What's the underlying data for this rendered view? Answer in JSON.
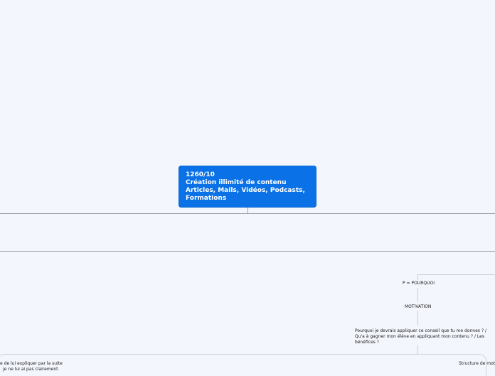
{
  "root": {
    "line1": "1260/10",
    "line2": "Création illimité de contenu",
    "line3": "Articles, Mails, Vidéos, Podcasts,",
    "line4": "Formations"
  },
  "nodes": {
    "p_pourquoi": "P = POURQUOI",
    "motivation": "MOTIVATION",
    "question_1": "Pourquoi je devrais appliquer ce conseil que tu me donnes ? /",
    "question_2": "Qu'a à gagner mon élève en appliquant mon contenu ? / Les",
    "question_3": "bénéfices ?",
    "left_fragment_1": "e de lui expliquer par la suite",
    "left_fragment_2": "je ne lui ai pas clairement",
    "right_fragment": "Structure de moti"
  },
  "colors": {
    "background": "#f4f6fd",
    "root_fill": "#0a72e6",
    "connector": "#9aa0aa"
  }
}
